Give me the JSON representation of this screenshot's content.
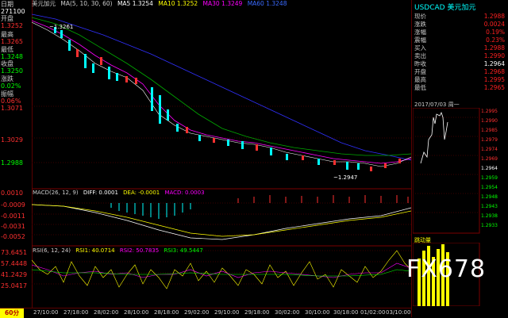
{
  "symbol_short": "美元加元",
  "ma_header": {
    "title": "MA(5, 10, 30, 60)",
    "ma5": "MA5 1.3254",
    "ma10": "MA10 1.3252",
    "ma30": "MA30 1.3249",
    "ma60": "MA60 1.3248"
  },
  "left_labels": {
    "date": "日期",
    "date_val": "271100",
    "open": "开盘",
    "open_val": "1.3252",
    "high": "最高",
    "high_val": "1.3265",
    "low": "最低",
    "low_val": "1.3248",
    "close": "收盘",
    "close_val": "1.3250",
    "change": "涨跌",
    "change_val": "0.02%",
    "amplitude": "振幅",
    "amplitude_val": "0.06%"
  },
  "price_axis": [
    "1.3071",
    "1.3029",
    "1.2988",
    "1.2947"
  ],
  "price_axis_top": "1.3261",
  "macd_header": {
    "title": "MACD(26, 12, 9)",
    "diff": "DIFF: 0.0001",
    "dea": "DEA: -0.0001",
    "macd": "MACD: 0.0003"
  },
  "macd_axis": [
    "0.0010",
    "-0.0009",
    "-0.0011",
    "-0.0031",
    "-0.0052"
  ],
  "rsi_header": {
    "title": "RSI(6, 12, 24)",
    "rsi1": "RSI1: 40.0714",
    "rsi2": "RSI2: 50.7835",
    "rsi3": "RSI3: 49.5447"
  },
  "rsi_axis": [
    "73.6451",
    "57.4448",
    "41.2429",
    "25.0417"
  ],
  "low_marker": "~1.2947",
  "high_marker": "~1.3261",
  "period": "60分",
  "time_axis": [
    "27/10:00",
    "27/18:00",
    "28/02:00",
    "28/10:00",
    "28/18:00",
    "29/02:00",
    "29/10:00",
    "29/18:00",
    "30/02:00",
    "30/10:00",
    "30/18:00",
    "01/02:00",
    "03/10:00"
  ],
  "right_panel": {
    "title": "USDCAD 美元加元",
    "rows": [
      {
        "k": "现价",
        "v": "1.2988"
      },
      {
        "k": "涨跌",
        "v": "0.0024"
      },
      {
        "k": "涨幅",
        "v": "0.19%"
      },
      {
        "k": "震幅",
        "v": "0.23%"
      },
      {
        "k": "买入",
        "v": "1.2988"
      },
      {
        "k": "卖出",
        "v": "1.2990"
      },
      {
        "k": "昨收",
        "v": "1.2964"
      },
      {
        "k": "开盘",
        "v": "1.2968"
      },
      {
        "k": "最高",
        "v": "1.2995"
      },
      {
        "k": "最低",
        "v": "1.2965"
      }
    ],
    "minichart_date": "2017/07/03",
    "minichart_weekday": "周一",
    "mini_axis": [
      "1.2995",
      "1.2990",
      "1.2985",
      "1.2979",
      "1.2974",
      "1.2969",
      "1.2964",
      "1.2959",
      "1.2954",
      "1.2948",
      "1.2943",
      "1.2938",
      "1.2933"
    ],
    "volume_label": "跳动量"
  },
  "logo_text": "FX678",
  "colors": {
    "up": "#ff3030",
    "down": "#00ffff",
    "ma5": "#ffffff",
    "ma10": "#ffff00",
    "ma30": "#ff00ff",
    "ma60": "#00ff00",
    "ma_long": "#3030ff"
  }
}
